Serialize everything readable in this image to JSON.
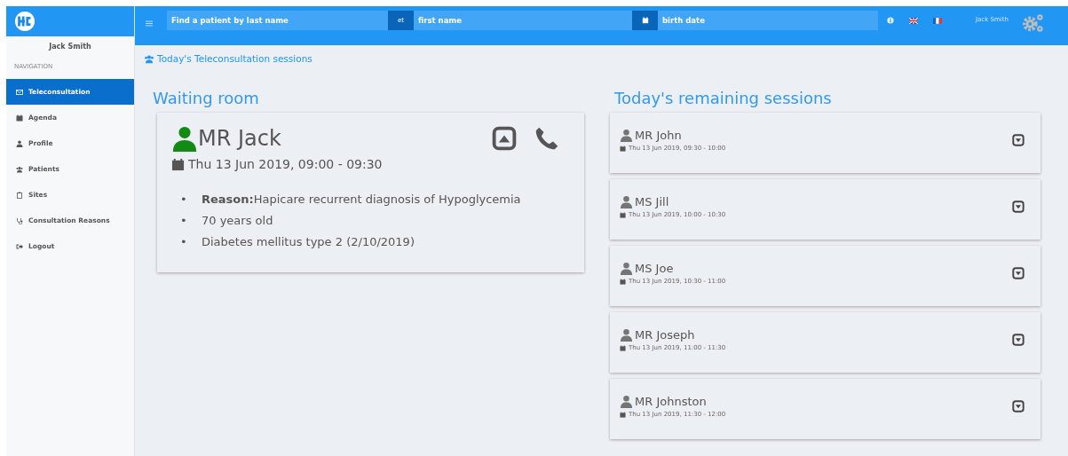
{
  "sidebar": {
    "user": "Jack Smith",
    "section": "NAVIGATION",
    "items": [
      {
        "label": "Teleconsultation",
        "kind": "envelope",
        "selected": true
      },
      {
        "label": "Agenda",
        "kind": "calendar",
        "selected": false
      },
      {
        "label": "Profile",
        "kind": "user",
        "selected": false
      },
      {
        "label": "Patients",
        "kind": "users",
        "selected": false
      },
      {
        "label": "Sites",
        "kind": "building",
        "selected": false
      },
      {
        "label": "Consultation Reasons",
        "kind": "stethoscope",
        "selected": false
      },
      {
        "label": "Logout",
        "kind": "logout",
        "selected": false
      }
    ]
  },
  "topbar": {
    "last_name": {
      "placeholder": "Find a patient by last name"
    },
    "joiner": "et",
    "first_name": {
      "placeholder": "first name"
    },
    "birth_date": {
      "placeholder": "birth date"
    },
    "user": "Jack Smith"
  },
  "breadcrumb": "Today's Teleconsultation sessions",
  "waiting": {
    "title": "Waiting room",
    "patient": {
      "name": "MR Jack",
      "online": true,
      "time": "Thu 13 Jun 2019, 09:00 - 09:30",
      "expanded": true,
      "details": [
        {
          "marker": "•",
          "text": "**Reason:**Hapicare recurrent diagnosis of Hypoglycemia"
        },
        {
          "marker": "•",
          "text": "70 years old"
        },
        {
          "marker": "•",
          "text": "Diabetes mellitus type 2 (2/10/2019)"
        }
      ]
    }
  },
  "remaining": {
    "title": "Today's remaining sessions",
    "sessions": [
      {
        "name": "MR John",
        "online": false,
        "time": "Thu 13 Jun 2019, 09:30 - 10:00",
        "expanded": false
      },
      {
        "name": "MS Jill",
        "online": false,
        "time": "Thu 13 Jun 2019, 10:00 - 10:30",
        "expanded": false
      },
      {
        "name": "MS Joe",
        "online": false,
        "time": "Thu 13 Jun 2019, 10:30 - 11:00",
        "expanded": false
      },
      {
        "name": "MR Joseph",
        "online": false,
        "time": "Thu 13 Jun 2019, 11:00 - 11:30",
        "expanded": false
      },
      {
        "name": "MR Johnston",
        "online": false,
        "time": "Thu 13 Jun 2019, 11:30 - 12:00",
        "expanded": false
      }
    ]
  }
}
